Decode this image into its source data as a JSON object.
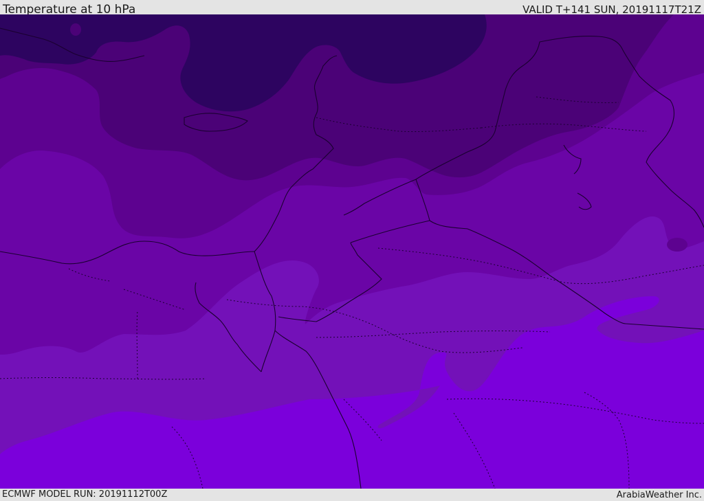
{
  "header": {
    "title": "Temperature at 10 hPa",
    "valid_time": "VALID T+141 SUN, 20191117T21Z"
  },
  "footer": {
    "model_run": "ECMWF MODEL RUN: 20191112T00Z",
    "credit": "ArabiaWeather Inc."
  },
  "map": {
    "variable": "temperature",
    "level": "10 hPa",
    "colors": {
      "band_darkest": "#2d0460",
      "band_dark": "#4b0277",
      "band_mid": "#5d0290",
      "band_light": "#6a05a6",
      "band_lighter": "#7311b8",
      "band_brightest": "#7b00db",
      "border_line": "#1a0030"
    }
  }
}
